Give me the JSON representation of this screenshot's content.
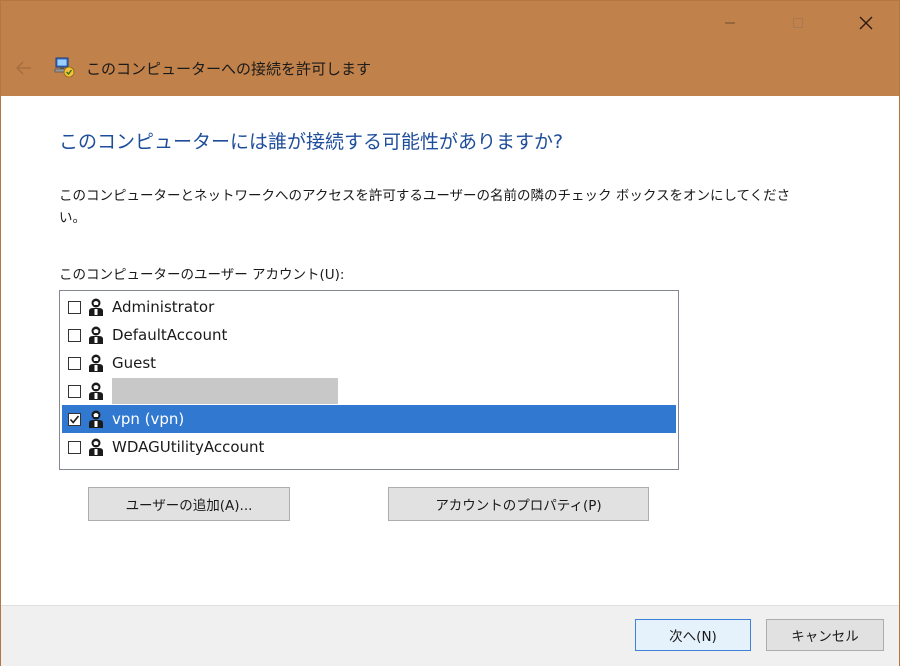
{
  "window": {
    "title": "このコンピューターへの接続を許可します",
    "caption_buttons": [
      "minimize-icon",
      "maximize-icon",
      "close-icon"
    ],
    "titlebar_color": "#c0814a"
  },
  "main": {
    "heading": "このコンピューターには誰が接続する可能性がありますか?",
    "description": "このコンピューターとネットワークへのアクセスを許可するユーザーの名前の隣のチェック ボックスをオンにしてください。",
    "list_label": "このコンピューターのユーザー アカウント(U):",
    "users": [
      {
        "label": "Administrator",
        "checked": false,
        "selected": false
      },
      {
        "label": "DefaultAccount",
        "checked": false,
        "selected": false
      },
      {
        "label": "Guest",
        "checked": false,
        "selected": false
      },
      {
        "label": "",
        "checked": false,
        "selected": false,
        "redacted": true
      },
      {
        "label": "vpn (vpn)",
        "checked": true,
        "selected": true
      },
      {
        "label": "WDAGUtilityAccount",
        "checked": false,
        "selected": false
      }
    ],
    "add_user_button": "ユーザーの追加(A)...",
    "account_properties_button": "アカウントのプロパティ(P)",
    "selection_color": "#3178d0"
  },
  "footer": {
    "next_button": "次へ(N)",
    "cancel_button": "キャンセル"
  }
}
